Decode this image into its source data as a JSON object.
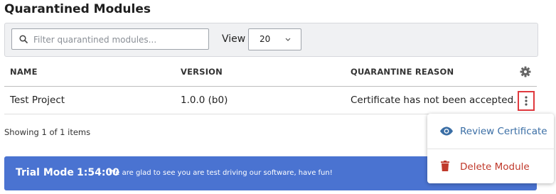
{
  "page": {
    "title": "Quarantined Modules"
  },
  "toolbar": {
    "search_placeholder": "Filter quarantined modules...",
    "search_value": "",
    "view_label": "View",
    "view_value": "20"
  },
  "table": {
    "columns": [
      "NAME",
      "VERSION",
      "QUARANTINE REASON"
    ],
    "rows": [
      {
        "name": "Test Project",
        "version": "1.0.0 (b0)",
        "reason": "Certificate has not been accepted."
      }
    ]
  },
  "footer": {
    "showing": "Showing 1 of 1 items"
  },
  "trial": {
    "mode": "Trial Mode",
    "time": "1:54:00",
    "message": "We are glad to see you are test driving our software, have fun!"
  },
  "menu": {
    "items": [
      {
        "label": "Review Certificate",
        "icon": "eye-icon",
        "color": "#3a6ea5"
      },
      {
        "label": "Delete Module",
        "icon": "trash-icon",
        "color": "#c0392b"
      }
    ]
  },
  "colors": {
    "trial_bar": "#4a73d1",
    "highlight_border": "#e0393e",
    "review_accent": "#3a6ea5",
    "delete_accent": "#c0392b"
  }
}
